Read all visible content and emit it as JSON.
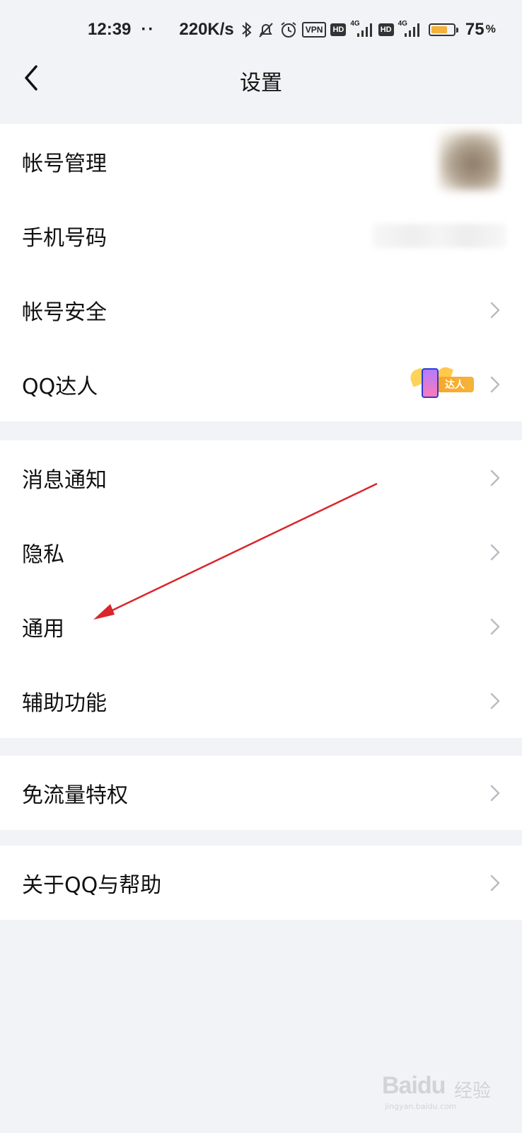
{
  "status_bar": {
    "time": "12:39",
    "dots": "··",
    "speed": "220K/s",
    "vpn": "VPN",
    "hd1": "HD",
    "net1": "4G",
    "hd2": "HD",
    "net2": "4G",
    "battery_level": 0.75,
    "battery_text": "75",
    "battery_unit": "%"
  },
  "header": {
    "back_icon": "chevron-left-icon",
    "title": "设置"
  },
  "sections": [
    {
      "items": [
        {
          "label": "帐号管理"
        },
        {
          "label": "手机号码"
        },
        {
          "label": "帐号安全"
        },
        {
          "label": "QQ达人",
          "badge_text": "达人"
        }
      ]
    },
    {
      "items": [
        {
          "label": "消息通知"
        },
        {
          "label": "隐私"
        },
        {
          "label": "通用"
        },
        {
          "label": "辅助功能"
        }
      ]
    },
    {
      "items": [
        {
          "label": "免流量特权"
        }
      ]
    },
    {
      "items": [
        {
          "label": "关于QQ与帮助"
        }
      ]
    }
  ],
  "annotation_color": "#d9252b",
  "watermark": {
    "logo": "Baidu",
    "cn": "经验",
    "url": "jingyan.baidu.com"
  }
}
